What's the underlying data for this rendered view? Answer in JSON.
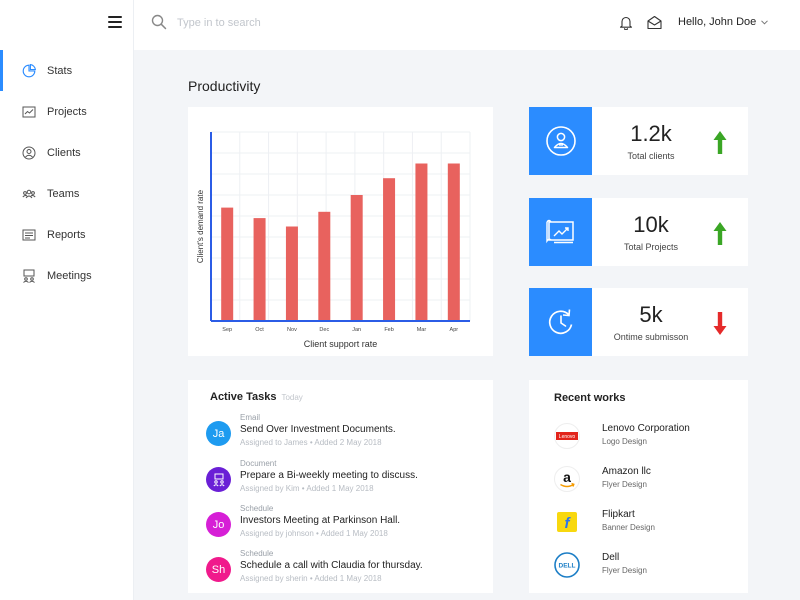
{
  "colors": {
    "accent": "#2b8cff",
    "bar": "#e8625e",
    "up": "#3aa625",
    "down": "#e52a2a"
  },
  "sidebar": {
    "items": [
      {
        "label": "Stats",
        "icon": "pie-chart-icon",
        "active": true
      },
      {
        "label": "Projects",
        "icon": "projects-icon"
      },
      {
        "label": "Clients",
        "icon": "user-circle-icon"
      },
      {
        "label": "Teams",
        "icon": "team-icon"
      },
      {
        "label": "Reports",
        "icon": "reports-icon"
      },
      {
        "label": "Meetings",
        "icon": "meetings-icon"
      }
    ]
  },
  "header": {
    "search": {
      "placeholder": "Type in to search",
      "value": ""
    },
    "user": "Hello, John Doe"
  },
  "page": {
    "title": "Productivity"
  },
  "chart_data": {
    "type": "bar",
    "categories": [
      "Sep",
      "Oct",
      "Nov",
      "Dec",
      "Jan",
      "Feb",
      "Mar",
      "Apr"
    ],
    "values": [
      54,
      49,
      45,
      52,
      60,
      68,
      75,
      75
    ],
    "xlabel": "Client support rate",
    "ylabel": "Client's demand rate",
    "ylim": [
      0,
      90
    ],
    "grid": true,
    "title": ""
  },
  "stats": [
    {
      "value": "1.2k",
      "label": "Total clients",
      "icon": "client-badge-icon",
      "trend": "up"
    },
    {
      "value": "10k",
      "label": "Total Projects",
      "icon": "project-board-icon",
      "trend": "up"
    },
    {
      "value": "5k",
      "label": "Ontime submisson",
      "icon": "clock-refresh-icon",
      "trend": "down"
    }
  ],
  "tasks": {
    "title": "Active Tasks",
    "subtitle": "Today",
    "items": [
      {
        "type": "Email",
        "title": "Send Over Investment Documents.",
        "meta": "Assigned to James • Added  2 May 2018",
        "avatar": "Ja",
        "color": "#1e9bf0"
      },
      {
        "type": "Document",
        "title": "Prepare a Bi-weekly meeting to discuss.",
        "meta": "Assigned by Kim • Added  1 May 2018",
        "avatar": "",
        "avatar_icon": "meeting-people-icon",
        "color": "#6a1fd6"
      },
      {
        "type": "Schedule",
        "title": "Investors Meeting at Parkinson Hall.",
        "meta": "Assigned by johnson • Added  1 May 2018",
        "avatar": "Jo",
        "color": "#d61fd6"
      },
      {
        "type": "Schedule",
        "title": "Schedule a call with Claudia for thursday.",
        "meta": "Assigned by sherin • Added  1 May 2018",
        "avatar": "Sh",
        "color": "#f01a8c"
      }
    ]
  },
  "works": {
    "title": "Recent works",
    "items": [
      {
        "name": "Lenovo Corporation",
        "type": "Logo Design",
        "logo": "lenovo-logo",
        "logo_text": "Lenovo"
      },
      {
        "name": "Amazon llc",
        "type": "Flyer Design",
        "logo": "amazon-logo",
        "logo_text": "a"
      },
      {
        "name": "Flipkart",
        "type": "Banner Design",
        "logo": "flipkart-logo",
        "logo_text": "f"
      },
      {
        "name": "Dell",
        "type": "Flyer Design",
        "logo": "dell-logo",
        "logo_text": "DELL"
      }
    ]
  }
}
